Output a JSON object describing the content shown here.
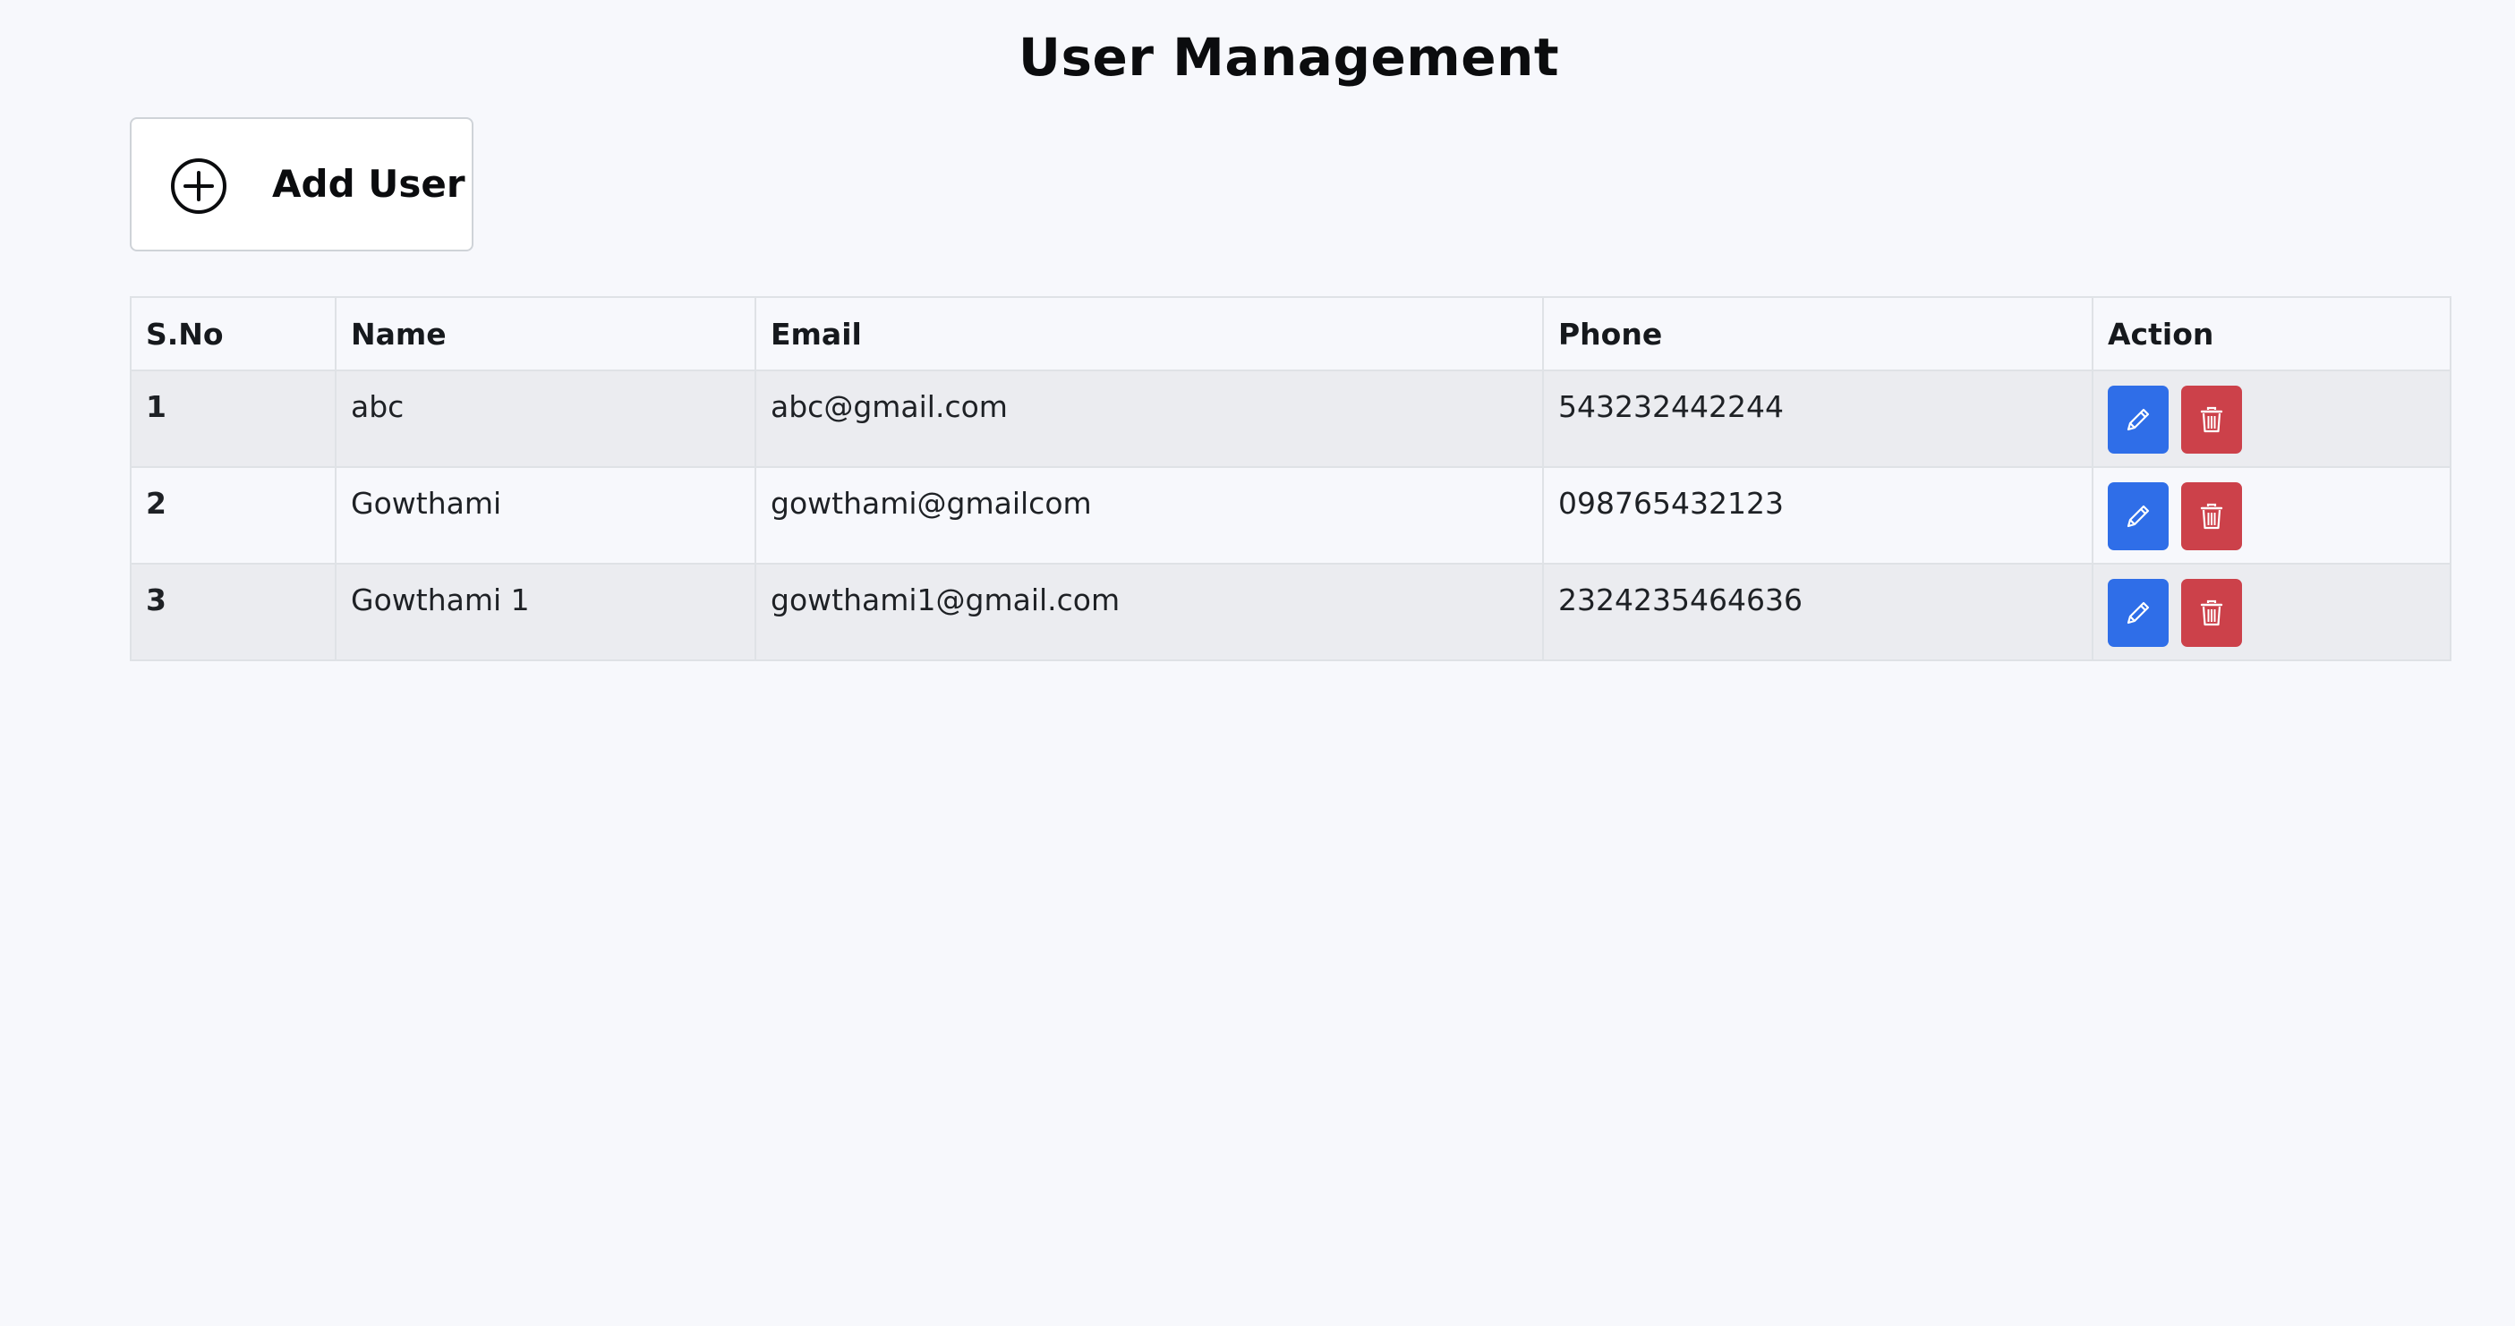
{
  "page": {
    "title": "User Management"
  },
  "toolbar": {
    "add_user_label": "Add User",
    "add_user_icon": "plus-circle-icon"
  },
  "table": {
    "headers": [
      "S.No",
      "Name",
      "Email",
      "Phone",
      "Action"
    ],
    "rows": [
      {
        "sno": "1",
        "name": "abc",
        "email": "abc@gmail.com",
        "phone": "543232442244"
      },
      {
        "sno": "2",
        "name": "Gowthami",
        "email": "gowthami@gmailcom",
        "phone": "098765432123"
      },
      {
        "sno": "3",
        "name": "Gowthami 1",
        "email": "gowthami1@gmail.com",
        "phone": "2324235464636"
      }
    ],
    "edit_icon": "pencil-icon",
    "delete_icon": "trash-icon"
  },
  "colors": {
    "background": "#f7f8fc",
    "edit_button": "#2f6ee8",
    "delete_button": "#cc414a",
    "odd_row": "#ebecf0"
  }
}
